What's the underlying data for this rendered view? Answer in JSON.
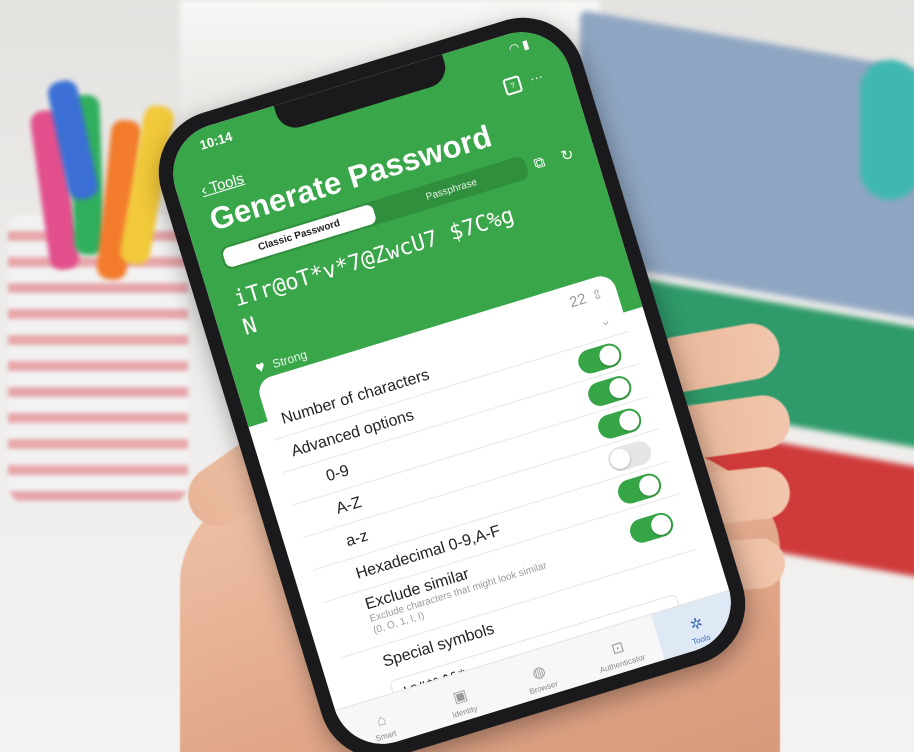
{
  "status_bar": {
    "time": "10:14"
  },
  "nav": {
    "back_label": "Tools"
  },
  "header": {
    "title": "Generate Password"
  },
  "mode_tabs": [
    {
      "label": "Classic Password",
      "active": true
    },
    {
      "label": "Passphrase",
      "active": false
    }
  ],
  "password": {
    "value": "iTr@oT*v*7@ZwcU7 $7C%gN",
    "strength": "Strong"
  },
  "options": {
    "length_value": "22",
    "number_of_characters_label": "Number of characters",
    "advanced_label": "Advanced options",
    "items": [
      {
        "label": "0-9",
        "on": true
      },
      {
        "label": "A-Z",
        "on": true
      },
      {
        "label": "a-z",
        "on": false
      },
      {
        "label": "Hexadecimal 0-9,A-F",
        "on": true
      },
      {
        "label": "Exclude similar",
        "on": true
      }
    ],
    "exclude_similar_desc": "Exclude characters that might look similar (0, O, 1, l, I)",
    "special_label": "Special symbols",
    "special_value": "!@#$%^&*"
  },
  "tabbar": [
    {
      "label": "Smart",
      "icon": "home-icon",
      "active": false
    },
    {
      "label": "Identity",
      "icon": "id-card-icon",
      "active": false
    },
    {
      "label": "Browser",
      "icon": "globe-icon",
      "active": false
    },
    {
      "label": "Authenticator",
      "icon": "lock-icon",
      "active": false
    },
    {
      "label": "Tools",
      "icon": "tools-icon",
      "active": true
    }
  ],
  "colors": {
    "accent": "#3aa64a",
    "toggle_on": "#35a545",
    "active_tab": "#3a6fb8"
  }
}
